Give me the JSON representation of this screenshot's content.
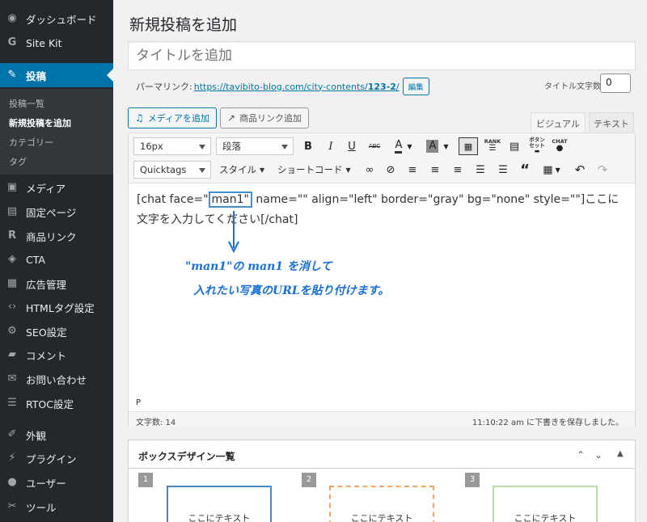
{
  "sidebar": {
    "items": [
      {
        "label": "ダッシュボード",
        "icon": "dashboard-icon"
      },
      {
        "label": "Site Kit",
        "icon": "google-g-icon"
      },
      {
        "label": "投稿",
        "icon": "pin-icon",
        "active": true
      },
      {
        "label": "メディア",
        "icon": "media-icon"
      },
      {
        "label": "固定ページ",
        "icon": "page-icon"
      },
      {
        "label": "商品リンク",
        "icon": "rinker-r-icon"
      },
      {
        "label": "CTA",
        "icon": "tag-icon"
      },
      {
        "label": "広告管理",
        "icon": "ad-icon"
      },
      {
        "label": "HTMLタグ設定",
        "icon": "code-icon"
      },
      {
        "label": "SEO設定",
        "icon": "gear-icon"
      },
      {
        "label": "コメント",
        "icon": "comment-icon"
      },
      {
        "label": "お問い合わせ",
        "icon": "mail-icon"
      },
      {
        "label": "RTOC設定",
        "icon": "list-icon"
      },
      {
        "label": "外観",
        "icon": "brush-icon"
      },
      {
        "label": "プラグイン",
        "icon": "plugin-icon"
      },
      {
        "label": "ユーザー",
        "icon": "user-icon"
      },
      {
        "label": "ツール",
        "icon": "wrench-icon"
      }
    ],
    "submenu": [
      "投稿一覧",
      "新規投稿を追加",
      "カテゴリー",
      "タグ"
    ]
  },
  "page_title": "新規投稿を追加",
  "title_placeholder": "タイトルを追加",
  "permalink": {
    "label": "パーマリンク:",
    "url_prefix": "https://tavibito-blog.com/city-contents/",
    "slug": "123-2",
    "url_suffix": "/",
    "edit_label": "編集"
  },
  "title_count": {
    "label": "タイトル文字数:",
    "value": "0"
  },
  "media_buttons": {
    "add_media": "メディアを追加",
    "add_product": "商品リンク追加"
  },
  "tabs": {
    "visual": "ビジュアル",
    "text": "テキスト"
  },
  "toolbar": {
    "font_size": "16px",
    "paragraph": "段落",
    "quicktags": "Quicktags",
    "style": "スタイル",
    "shortcode": "ショートコード",
    "rank": "RANK",
    "button_set": "ボタン\nセット",
    "chat": "CHAT"
  },
  "content": {
    "before": "[chat face=\"",
    "highlight": "man1\"",
    "after": " name=\"\" align=\"left\" border=\"gray\" bg=\"none\" style=\"\"]ここに文字を入力してください[/chat]"
  },
  "annotation": {
    "line1": "\"man1\"の man1 を消して",
    "line2": "入れたい写真のURLを貼り付けます。"
  },
  "status": {
    "path": "P",
    "word_count": "文字数: 14",
    "draft_saved": "11:10:22 am に下書きを保存しました。"
  },
  "box_panel": {
    "title": "ボックスデザイン一覧",
    "boxes": [
      {
        "num": "1",
        "label": "ここにテキスト",
        "border": "#4a89c8"
      },
      {
        "num": "2",
        "label": "ここにテキスト",
        "border": "#f0a868"
      },
      {
        "num": "3",
        "label": "ここにテキスト",
        "border": "#b8dca8"
      }
    ]
  }
}
